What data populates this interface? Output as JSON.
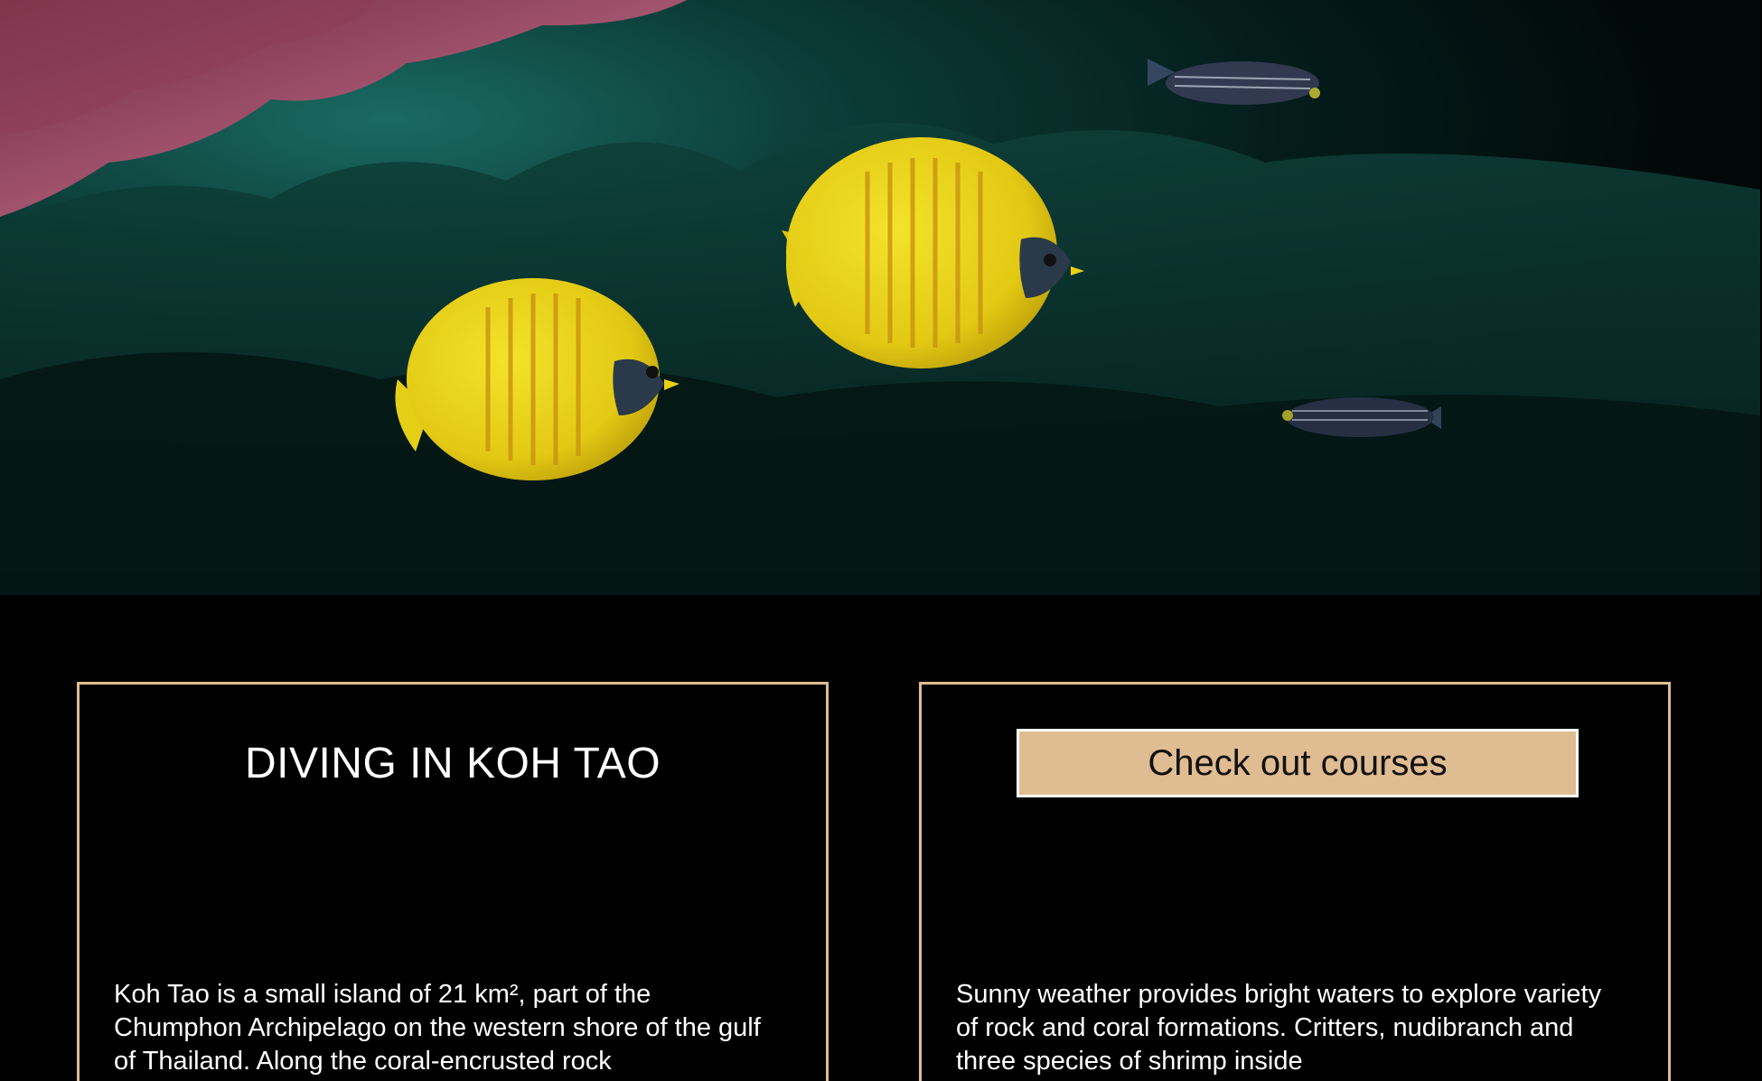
{
  "hero": {
    "image_alt": "Two yellow butterflyfish swimming over a dark coral reef"
  },
  "intro_card": {
    "title": "DIVING IN KOH TAO",
    "text": "Koh Tao is a small island of 21 km², part of the Chumphon Archipelago on the western shore of the gulf of Thailand. Along the coral-encrusted rock"
  },
  "courses_card": {
    "button_label": "Check out courses",
    "text": "Sunny weather provides bright waters to explore variety of rock and coral formations. Critters, nudibranch and three species of shrimp inside"
  },
  "colors": {
    "accent": "#e0bc92",
    "background": "#000000",
    "text": "#ffffff"
  }
}
